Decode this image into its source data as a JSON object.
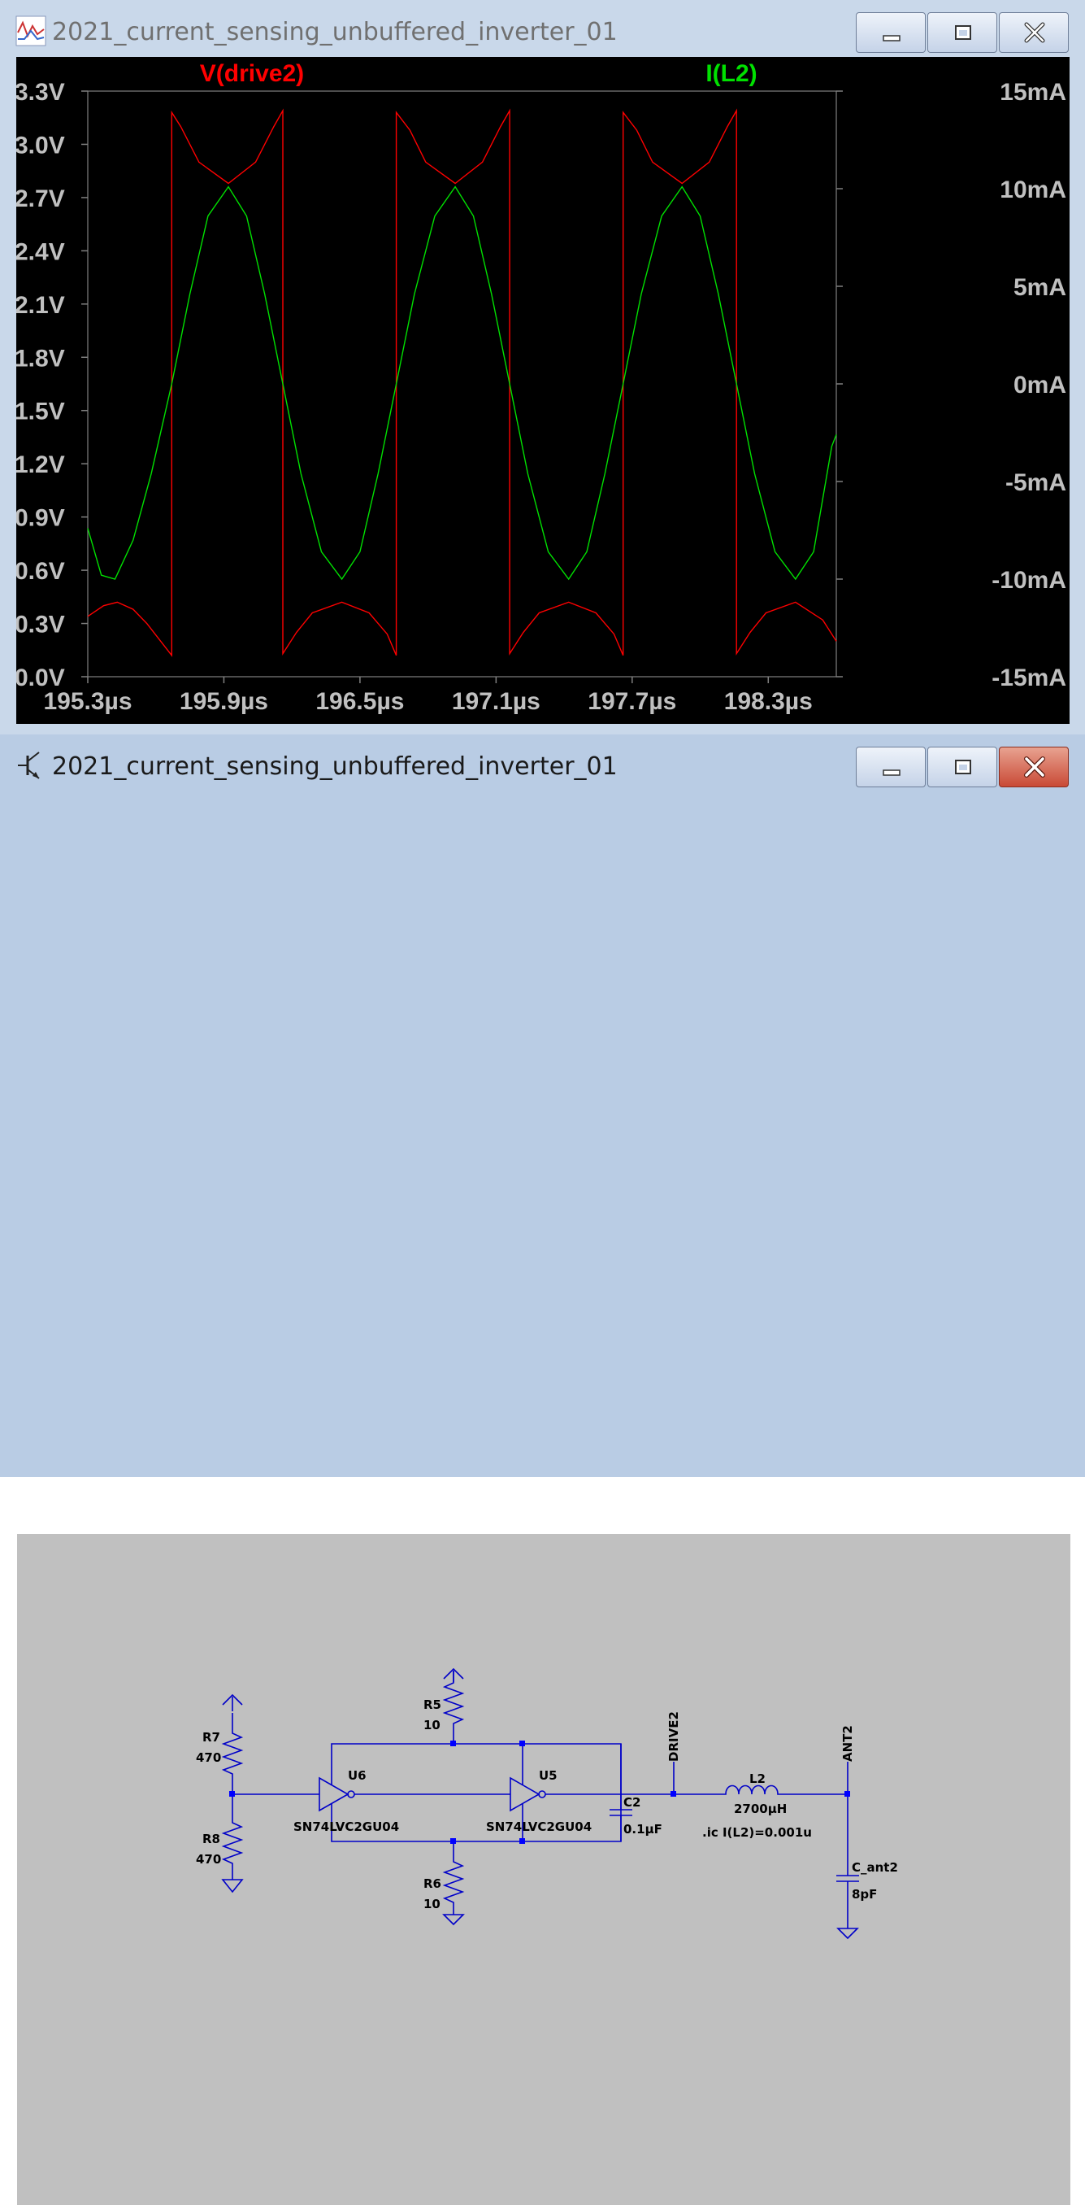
{
  "plot_window": {
    "title": "2021_current_sensing_unbuffered_inverter_01",
    "icon": "waveform-icon",
    "buttons": [
      "minimize-icon",
      "maximize-icon",
      "close-icon"
    ]
  },
  "chart_data": {
    "type": "line",
    "xlim": [
      195.3,
      198.6
    ],
    "x_ticks": [
      "195.3µs",
      "195.9µs",
      "196.5µs",
      "197.1µs",
      "197.7µs",
      "198.3µs"
    ],
    "x_tick_values": [
      195.3,
      195.9,
      196.5,
      197.1,
      197.7,
      198.3
    ],
    "ylim_left": [
      0.0,
      3.3
    ],
    "y_ticks_left": [
      "3.3V",
      "3.0V",
      "2.7V",
      "2.4V",
      "2.1V",
      "1.8V",
      "1.5V",
      "1.2V",
      "0.9V",
      "0.6V",
      "0.3V",
      "0.0V"
    ],
    "y_tick_values_left": [
      3.3,
      3.0,
      2.7,
      2.4,
      2.1,
      1.8,
      1.5,
      1.2,
      0.9,
      0.6,
      0.3,
      0.0
    ],
    "ylim_right": [
      -15,
      15
    ],
    "y_ticks_right": [
      "15mA",
      "10mA",
      "5mA",
      "0mA",
      "-5mA",
      "-10mA",
      "-15mA"
    ],
    "y_tick_values_right": [
      15,
      10,
      5,
      0,
      -5,
      -10,
      -15
    ],
    "series": [
      {
        "name": "V(drive2)",
        "color": "#ff0000",
        "axis": "left",
        "x": [
          195.3,
          195.37,
          195.43,
          195.5,
          195.56,
          195.67,
          195.67,
          195.71,
          195.79,
          195.92,
          196.04,
          196.12,
          196.16,
          196.16,
          196.22,
          196.29,
          196.42,
          196.54,
          196.62,
          196.66,
          196.66,
          196.72,
          196.79,
          196.92,
          197.04,
          197.12,
          197.16,
          197.16,
          197.22,
          197.29,
          197.42,
          197.54,
          197.62,
          197.66,
          197.66,
          197.72,
          197.79,
          197.92,
          198.04,
          198.12,
          198.16,
          198.16,
          198.22,
          198.29,
          198.42,
          198.54,
          198.6
        ],
        "y": [
          0.34,
          0.4,
          0.42,
          0.38,
          0.3,
          0.12,
          3.18,
          3.1,
          2.9,
          2.78,
          2.9,
          3.1,
          3.19,
          0.13,
          0.25,
          0.36,
          0.42,
          0.36,
          0.24,
          0.12,
          3.18,
          3.08,
          2.9,
          2.78,
          2.9,
          3.1,
          3.19,
          0.13,
          0.25,
          0.36,
          0.42,
          0.36,
          0.24,
          0.12,
          3.18,
          3.08,
          2.9,
          2.78,
          2.9,
          3.1,
          3.19,
          0.13,
          0.25,
          0.36,
          0.42,
          0.32,
          0.2
        ]
      },
      {
        "name": "I(L2)",
        "color": "#00e000",
        "axis": "right",
        "x": [
          195.3,
          195.36,
          195.42,
          195.5,
          195.58,
          195.67,
          195.75,
          195.83,
          195.92,
          196.0,
          196.08,
          196.16,
          196.24,
          196.33,
          196.42,
          196.5,
          196.58,
          196.66,
          196.74,
          196.83,
          196.92,
          197.0,
          197.08,
          197.16,
          197.24,
          197.33,
          197.42,
          197.5,
          197.58,
          197.66,
          197.74,
          197.83,
          197.92,
          198.0,
          198.08,
          198.16,
          198.24,
          198.33,
          198.42,
          198.5,
          198.58,
          198.6
        ],
        "y": [
          -7.4,
          -9.8,
          -10.0,
          -8.0,
          -4.6,
          0.0,
          4.6,
          8.6,
          10.1,
          8.6,
          4.6,
          0.0,
          -4.6,
          -8.6,
          -10.0,
          -8.6,
          -4.6,
          0.0,
          4.6,
          8.6,
          10.1,
          8.6,
          4.6,
          0.0,
          -4.6,
          -8.6,
          -10.0,
          -8.6,
          -4.6,
          0.0,
          4.6,
          8.6,
          10.1,
          8.6,
          4.6,
          0.0,
          -4.6,
          -8.6,
          -10.0,
          -8.6,
          -3.2,
          -2.6
        ]
      }
    ],
    "grid": false
  },
  "schematic_window": {
    "title": "2021_current_sensing_unbuffered_inverter_01",
    "icon": "transistor-icon",
    "buttons": [
      "minimize-icon",
      "maximize-icon",
      "close-icon"
    ],
    "labels": {
      "r7_name": "R7",
      "r7_value": "470",
      "r8_name": "R8",
      "r8_value": "470",
      "r5_name": "R5",
      "r5_value": "10",
      "r6_name": "R6",
      "r6_value": "10",
      "u6_name": "U6",
      "u6_part": "SN74LVC2GU04",
      "u5_name": "U5",
      "u5_part": "SN74LVC2GU04",
      "c2_name": "C2",
      "c2_value": "0.1µF",
      "net_drive2": "DRIVE2",
      "l2_name": "L2",
      "l2_value": "2700µH",
      "ic_directive": ".ic I(L2)=0.001u",
      "net_ant2": "ANT2",
      "cant2_name": "C_ant2",
      "cant2_value": "8pF"
    },
    "wire_color": "#0000c8",
    "junction_color": "#0000ff"
  }
}
